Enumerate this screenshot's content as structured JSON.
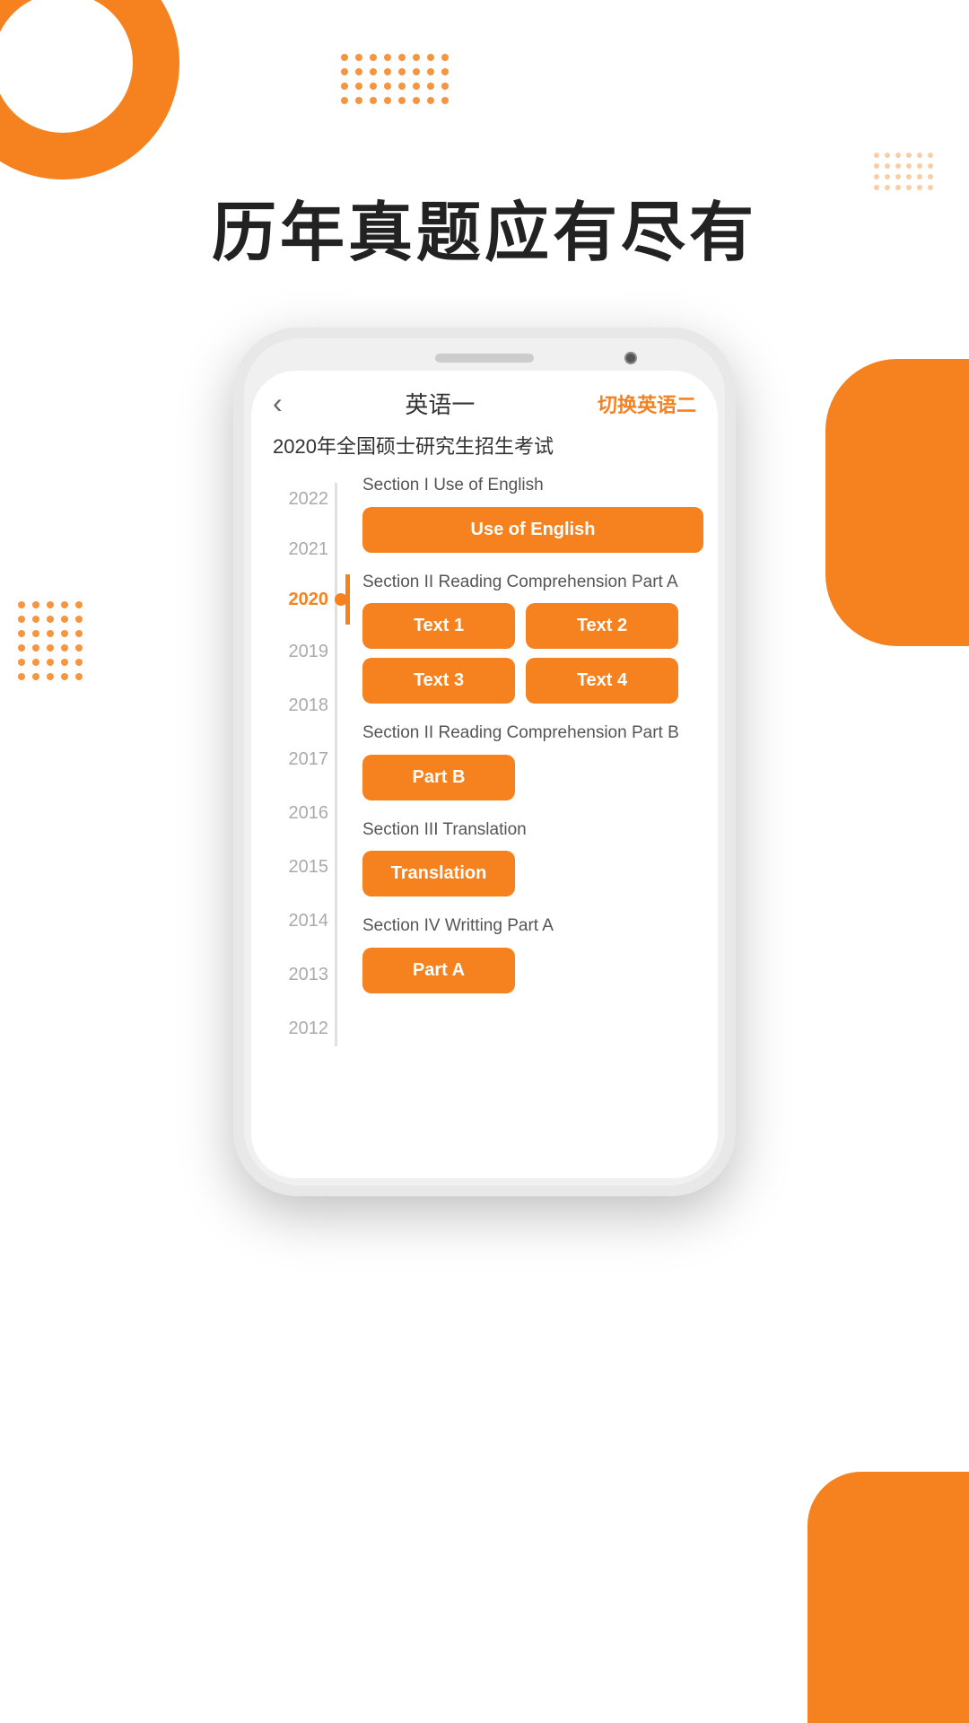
{
  "background": {
    "accent_color": "#f5821f",
    "dots_color": "#f5821f"
  },
  "main_title": "历年真题应有尽有",
  "phone": {
    "header": {
      "back_icon": "‹",
      "title": "英语一",
      "switch_label": "切换英语二"
    },
    "subtitle": "2020年全国硕士研究生招生考试",
    "timeline": {
      "years": [
        "2022",
        "2021",
        "2020",
        "2019",
        "2018",
        "2017",
        "2016",
        "2015",
        "2014",
        "2013",
        "2012"
      ],
      "active_year": "2020"
    },
    "sections": [
      {
        "id": "section1",
        "label": "Section I Use of English",
        "buttons": [
          {
            "label": "Use of English",
            "wide": true
          }
        ]
      },
      {
        "id": "section2a",
        "label": "Section II Reading Comprehension Part A",
        "buttons": [
          {
            "label": "Text 1"
          },
          {
            "label": "Text 2"
          },
          {
            "label": "Text 3"
          },
          {
            "label": "Text 4"
          }
        ]
      },
      {
        "id": "section2b",
        "label": "Section II Reading Comprehension Part B",
        "buttons": [
          {
            "label": "Part B",
            "wide": false
          }
        ]
      },
      {
        "id": "section3",
        "label": "Section III Translation",
        "buttons": [
          {
            "label": "Translation"
          }
        ]
      },
      {
        "id": "section4",
        "label": "Section IV Writting Part A",
        "buttons": [
          {
            "label": "Part A"
          }
        ]
      }
    ]
  },
  "dots_grid_top": {
    "cols": 8,
    "rows": 4
  },
  "dots_grid_top_right": {
    "cols": 6,
    "rows": 4
  },
  "dots_grid_left": {
    "cols": 5,
    "rows": 6
  }
}
